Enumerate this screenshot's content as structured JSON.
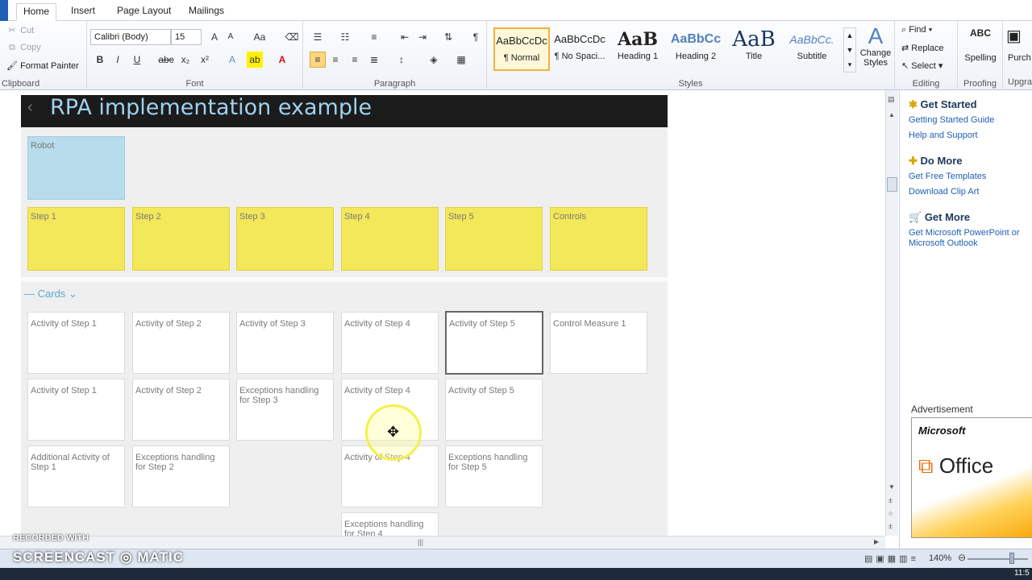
{
  "tabs": [
    {
      "label": "Home",
      "active": true
    },
    {
      "label": "Insert",
      "active": false
    },
    {
      "label": "Page Layout",
      "active": false
    },
    {
      "label": "Mailings",
      "active": false
    }
  ],
  "clipboard": {
    "cut": "Cut",
    "copy": "Copy",
    "format_painter": "Format Painter",
    "label": "Clipboard"
  },
  "font": {
    "name": "Calibri (Body)",
    "size": "15",
    "label": "Font"
  },
  "paragraph": {
    "label": "Paragraph"
  },
  "styles": {
    "label": "Styles",
    "items": [
      {
        "sample": "AaBbCcDc",
        "name": "¶ Normal",
        "selected": true
      },
      {
        "sample": "AaBbCcDc",
        "name": "¶ No Spaci...",
        "selected": false
      },
      {
        "sample": "AaB",
        "name": "Heading 1",
        "selected": false
      },
      {
        "sample": "AaBbCc",
        "name": "Heading 2",
        "selected": false
      },
      {
        "sample": "AaB",
        "name": "Title",
        "selected": false
      },
      {
        "sample": "AaBbCc.",
        "name": "Subtitle",
        "selected": false
      }
    ],
    "change_styles": "Change Styles"
  },
  "editing": {
    "find": "Find",
    "replace": "Replace",
    "select": "Select",
    "label": "Editing"
  },
  "proofing": {
    "spelling": "Spelling",
    "label": "Proofing",
    "abc": "ABC"
  },
  "purchase": {
    "label": "Purch",
    "upgrade": "Upgra"
  },
  "document": {
    "title": "RPA implementation example",
    "robot_label": "Robot",
    "steps": [
      "Step 1",
      "Step 2",
      "Step 3",
      "Step 4",
      "Step 5",
      "Controls"
    ],
    "cards_heading": "Cards",
    "cards": [
      [
        "Activity of Step 1",
        "Activity of Step 2",
        "Activity of Step 3",
        "Activity of Step 4",
        "Activity of Step 5",
        "Control Measure 1"
      ],
      [
        "Activity of Step 1",
        "Activity of Step 2",
        "Exceptions handling for Step 3",
        "Activity of Step 4",
        "Activity of Step 5",
        ""
      ],
      [
        "Additional Activity of Step 1",
        "Exceptions handling for Step 2",
        "",
        "Activity of Step 4",
        "Exceptions handling for Step 5",
        ""
      ],
      [
        "",
        "",
        "",
        "Exceptions handling for Step 4",
        "",
        ""
      ]
    ]
  },
  "pane": {
    "get_started": "Get Started",
    "getting_started_guide": "Getting Started Guide",
    "help_support": "Help and Support",
    "do_more": "Do More",
    "free_templates": "Get Free Templates",
    "clip_art": "Download Clip Art",
    "get_more": "Get More",
    "get_more_link": "Get Microsoft PowerPoint or Microsoft Outlook",
    "advertisement": "Advertisement",
    "ad_brand": "Microsoft",
    "ad_product": "Office"
  },
  "status": {
    "zoom": "140%",
    "time": "11:5",
    "recorded_with": "RECORDED WITH",
    "screencast": "SCREENCAST ◎ MATIC"
  }
}
